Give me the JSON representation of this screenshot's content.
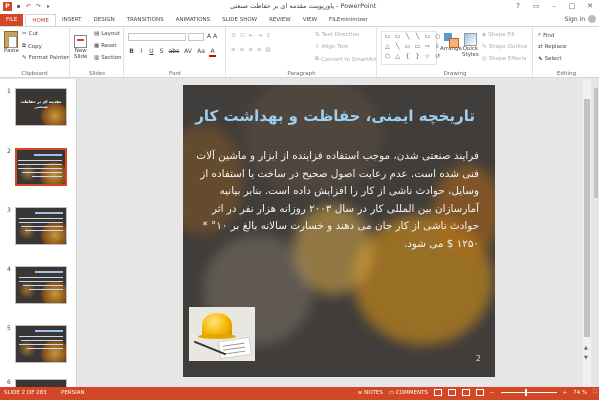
{
  "window": {
    "title": "پاورپوینت مقدمه ای بر حفاظت صنعتی - PowerPoint",
    "sign_in": "Sign in",
    "controls": [
      "?",
      "▭",
      "–",
      "□",
      "✕"
    ]
  },
  "quick_access": [
    "save-icon",
    "undo-icon",
    "redo-icon",
    "start-slideshow-icon"
  ],
  "tabs": [
    "FILE",
    "HOME",
    "INSERT",
    "DESIGN",
    "TRANSITIONS",
    "ANIMATIONS",
    "SLIDE SHOW",
    "REVIEW",
    "VIEW",
    "FILEminimizer"
  ],
  "active_tab": "HOME",
  "ribbon": {
    "clipboard": {
      "paste": "Paste",
      "cut": "Cut",
      "copy": "Copy",
      "format_painter": "Format Painter",
      "label": "Clipboard"
    },
    "slides": {
      "new_slide": "New",
      "new_slide2": "Slide",
      "layout": "Layout",
      "reset": "Reset",
      "section": "Section",
      "label": "Slides"
    },
    "font": {
      "label": "Font",
      "buttons": [
        "B",
        "I",
        "U",
        "S",
        "abc",
        "AV",
        "Aa",
        "A"
      ]
    },
    "paragraph": {
      "text_direction": "Text Direction",
      "align_text": "Align Text",
      "convert_smartart": "Convert to SmartArt",
      "label": "Paragraph"
    },
    "drawing": {
      "arrange": "Arrange",
      "quick_styles": "Quick",
      "quick_styles2": "Styles",
      "shape_fill": "Shape Fill",
      "shape_outline": "Shape Outline",
      "shape_effects": "Shape Effects",
      "label": "Drawing",
      "shapes": [
        "▭",
        "▭",
        "╲",
        "╲",
        "▭",
        "○",
        "△",
        "╲",
        "▭",
        "▭",
        "⇨",
        "⇩",
        "⬡",
        "△",
        "{",
        "}",
        "☆",
        "↺"
      ]
    },
    "editing": {
      "find": "Find",
      "replace": "Replace",
      "select": "Select",
      "label": "Editing"
    }
  },
  "thumbnails": [
    {
      "num": "1",
      "title": "مقدمه ای بر حفاظت صنعتی",
      "selected": false
    },
    {
      "num": "2",
      "title": "",
      "selected": true
    },
    {
      "num": "3",
      "title": "",
      "selected": false
    },
    {
      "num": "4",
      "title": "",
      "selected": false
    },
    {
      "num": "5",
      "title": "",
      "selected": false
    },
    {
      "num": "6",
      "title": "",
      "selected": false
    }
  ],
  "slide": {
    "title": "تاریخچه ایمنی، حفاظت و بهداشت کار",
    "body": "فرایند صنعتی شدن، موجب استفاده فزاینده از ابزار و ماشین آلات فنی شده است. عدم رعایت اصول صحیح در ساخت یا استفاده از وسایل، حوادث ناشی از کار را افزایش داده است. بنابر بیانیه آمارسازان بین المللی کار در سال ۲۰۰۳ روزانه هزار نفر در اثر حوادث ناشی از کار جان می دهند و خسارت سالانه بالغ بر ۱۰° * ۱۲۵۰ $ می شود.",
    "number": "2"
  },
  "status": {
    "slide_info": "SLIDE 2 OF 283",
    "language": "PERSIAN",
    "notes": "NOTES",
    "comments": "COMMENTS",
    "zoom": "74 %"
  },
  "colors": {
    "accent": "#d24726",
    "title": "#9dcff3"
  }
}
